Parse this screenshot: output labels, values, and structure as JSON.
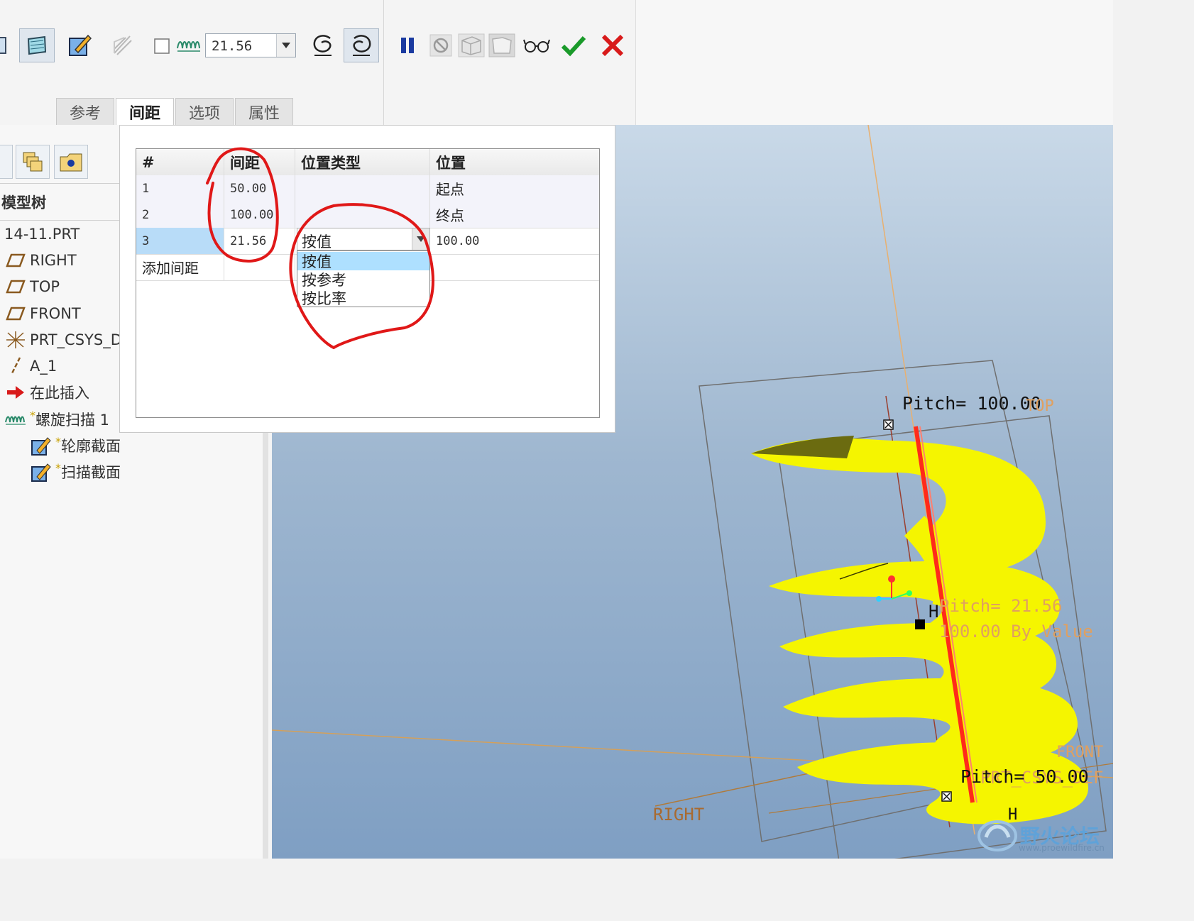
{
  "toolbar": {
    "pitch_value": "21.56",
    "icons": [
      "surface-icon",
      "sketch-edit-icon",
      "thicken-icon",
      "profile-checkbox",
      "helix-pitch-icon",
      "left-handed-icon",
      "right-handed-icon",
      "pause-icon",
      "no-preview-icon",
      "preview-icon",
      "verify-icon",
      "glasses-icon",
      "confirm-check-icon",
      "cancel-x-icon"
    ]
  },
  "tabs": [
    {
      "label": "参考"
    },
    {
      "label": "间距"
    },
    {
      "label": "选项"
    },
    {
      "label": "属性"
    }
  ],
  "tree": {
    "title": "模型树",
    "items": [
      {
        "label": "14-11.PRT",
        "icon": "part-icon"
      },
      {
        "label": "RIGHT",
        "icon": "datum-plane-icon"
      },
      {
        "label": "TOP",
        "icon": "datum-plane-icon"
      },
      {
        "label": "FRONT",
        "icon": "datum-plane-icon"
      },
      {
        "label": "PRT_CSYS_D",
        "icon": "csys-icon"
      },
      {
        "label": "A_1",
        "icon": "axis-icon"
      },
      {
        "label": "在此插入",
        "icon": "insert-arrow-icon"
      },
      {
        "label": "螺旋扫描 1",
        "icon": "helix-sweep-icon",
        "marker": "*"
      },
      {
        "label": "轮廓截面",
        "icon": "sketch-icon",
        "marker": "*"
      },
      {
        "label": "扫描截面",
        "icon": "sketch-icon",
        "marker": "*"
      }
    ]
  },
  "pitch_table": {
    "headers": [
      "#",
      "间距",
      "位置类型",
      "位置"
    ],
    "rows": [
      {
        "num": "1",
        "pitch": "50.00",
        "type": "",
        "location": "起点"
      },
      {
        "num": "2",
        "pitch": "100.00",
        "type": "",
        "location": "终点"
      },
      {
        "num": "3",
        "pitch": "21.56",
        "type": "按值",
        "location": "100.00"
      }
    ],
    "add_row_label": "添加间距",
    "dropdown_options": [
      "按值",
      "按参考",
      "按比率"
    ],
    "dropdown_selected": "按值"
  },
  "viewport": {
    "labels": {
      "pitch_top": "Pitch= 100.00",
      "pitch_mid": "Pitch= 21.56",
      "pitch_mid_sub": "100.00 By Value",
      "pitch_bottom": "Pitch= 50.00",
      "plane_top": "TOP",
      "plane_front": "FRONT",
      "plane_right": "RIGHT",
      "csys": "PRT_CSYS_DEF",
      "handle": "H"
    },
    "colors": {
      "surface": "#f5f500",
      "axis": "#ff2a1a",
      "label_dark": "#111111",
      "label_orange": "#e0a060"
    }
  },
  "watermark": {
    "text": "野火论坛",
    "url": "www.proewildfire.cn"
  }
}
